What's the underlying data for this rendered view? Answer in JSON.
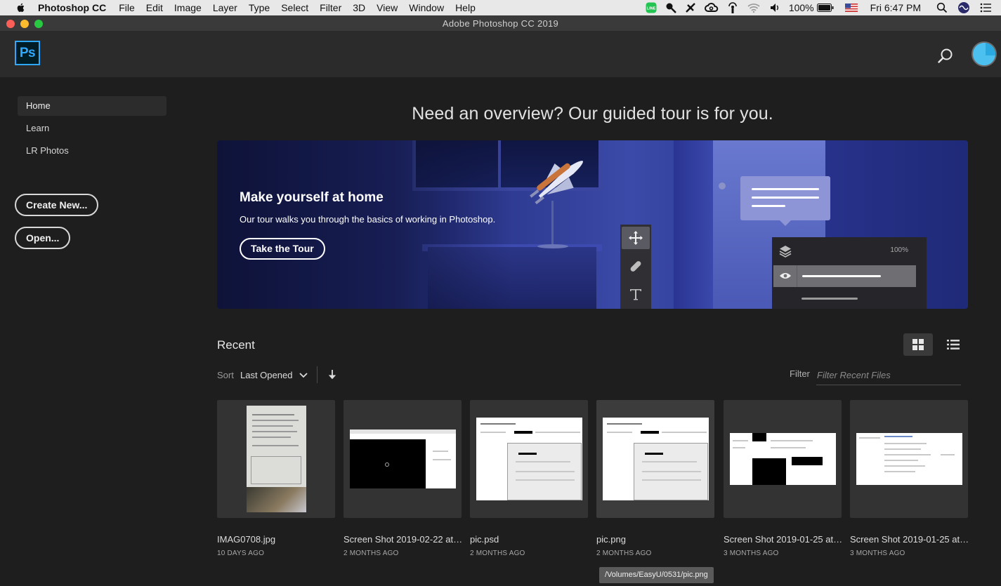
{
  "menubar": {
    "app_name": "Photoshop CC",
    "items": [
      "File",
      "Edit",
      "Image",
      "Layer",
      "Type",
      "Select",
      "Filter",
      "3D",
      "View",
      "Window",
      "Help"
    ],
    "battery": "100%",
    "clock": "Fri 6:47 PM"
  },
  "window": {
    "title": "Adobe Photoshop CC 2019"
  },
  "header": {
    "logo": "Ps"
  },
  "sidebar": {
    "items": [
      {
        "label": "Home",
        "active": true
      },
      {
        "label": "Learn",
        "active": false
      },
      {
        "label": "LR Photos",
        "active": false
      }
    ],
    "create_new": "Create New...",
    "open": "Open..."
  },
  "main": {
    "headline": "Need an overview? Our guided tour is for you.",
    "banner": {
      "title": "Make yourself at home",
      "subtitle": "Our tour walks you through the basics of working in Photoshop.",
      "button": "Take the Tour",
      "layers_opacity": "100%"
    },
    "recent": {
      "title": "Recent",
      "sort_label": "Sort",
      "sort_value": "Last Opened",
      "filter_label": "Filter",
      "filter_placeholder": "Filter Recent Files",
      "files": [
        {
          "name": "IMAG0708.jpg",
          "date": "10 DAYS AGO"
        },
        {
          "name": "Screen Shot 2019-02-22 at 6...",
          "date": "2 MONTHS AGO"
        },
        {
          "name": "pic.psd",
          "date": "2 MONTHS AGO"
        },
        {
          "name": "pic.png",
          "date": "2 MONTHS AGO"
        },
        {
          "name": "Screen Shot 2019-01-25 at 8....",
          "date": "3 MONTHS AGO"
        },
        {
          "name": "Screen Shot 2019-01-25 at 8....",
          "date": "3 MONTHS AGO"
        }
      ],
      "hover_path": "/Volumes/EasyU/0531/pic.png"
    }
  },
  "colors": {
    "accent": "#31a8ff",
    "background": "#1e1e1e",
    "header": "#2b2b2b",
    "card": "#333333"
  },
  "icons": {
    "apple": "apple-icon",
    "search": "search-icon",
    "grid": "grid-view-icon",
    "list": "list-view-icon",
    "sort_direction": "arrow-down-icon",
    "chevron": "chevron-down-icon",
    "move_tool": "move-tool-icon",
    "healing_tool": "bandage-icon",
    "type_tool": "type-tool-icon",
    "layers": "layers-icon",
    "visibility": "eye-icon"
  }
}
